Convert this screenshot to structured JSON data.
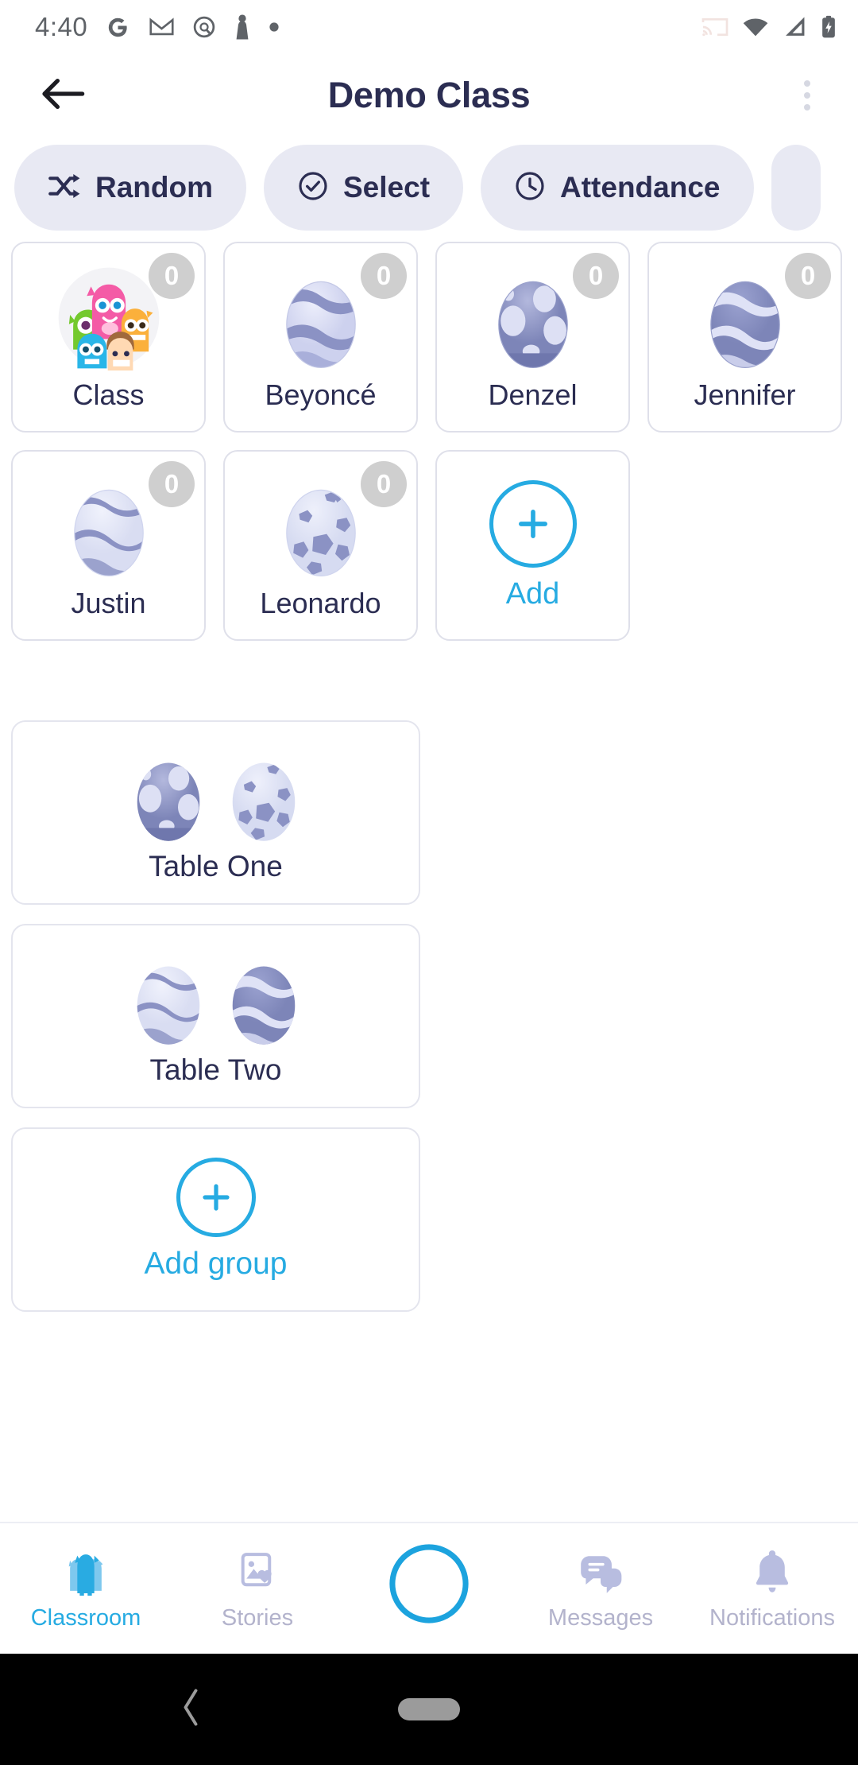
{
  "status_bar": {
    "time": "4:40",
    "left_icons": [
      "google-icon",
      "gmail-icon",
      "chat-icon",
      "chess-pawn-icon",
      "dot-icon"
    ],
    "right_icons": [
      "cast-icon",
      "wifi-icon",
      "cellular-signal-icon",
      "battery-charging-icon"
    ]
  },
  "header": {
    "back_icon": "back-arrow-icon",
    "title": "Demo Class",
    "menu_icon": "kebab-menu-icon"
  },
  "toolbar": {
    "pills": [
      {
        "label": "Random",
        "icon": "shuffle-icon"
      },
      {
        "label": "Select",
        "icon": "check-circle-icon"
      },
      {
        "label": "Attendance",
        "icon": "clock-icon"
      }
    ],
    "partial_pill_visible": true
  },
  "students": [
    {
      "name": "Class",
      "points": "0",
      "avatar": "class-monsters-avatar"
    },
    {
      "name": "Beyoncé",
      "points": "0",
      "avatar": "egg-wave-light-avatar"
    },
    {
      "name": "Denzel",
      "points": "0",
      "avatar": "egg-spotted-dark-avatar"
    },
    {
      "name": "Jennifer",
      "points": "0",
      "avatar": "egg-wave-dark-avatar"
    },
    {
      "name": "Justin",
      "points": "0",
      "avatar": "egg-wave-pale-avatar"
    },
    {
      "name": "Leonardo",
      "points": "0",
      "avatar": "egg-rock-pale-avatar"
    }
  ],
  "add_student": {
    "label": "Add",
    "icon": "plus-circle-icon"
  },
  "groups": [
    {
      "name": "Table One",
      "avatars": [
        "egg-spotted-dark-avatar",
        "egg-rock-pale-avatar"
      ]
    },
    {
      "name": "Table Two",
      "avatars": [
        "egg-wave-pale-avatar",
        "egg-wave-dark-avatar"
      ]
    }
  ],
  "add_group": {
    "label": "Add group",
    "icon": "plus-circle-icon"
  },
  "bottom_nav": [
    {
      "label": "Classroom",
      "icon": "classroom-monsters-icon",
      "active": true
    },
    {
      "label": "Stories",
      "icon": "stories-photo-heart-icon",
      "active": false
    },
    {
      "label": "",
      "icon": "camera-shutter-icon",
      "active": false
    },
    {
      "label": "Messages",
      "icon": "messages-bubbles-icon",
      "active": false
    },
    {
      "label": "Notifications",
      "icon": "bell-icon",
      "active": false
    }
  ],
  "android_nav": {
    "back_icon": "system-back-icon",
    "home_icon": "system-home-pill-icon"
  },
  "colors": {
    "accent": "#26ABE2",
    "title_navy": "#2b2d52",
    "pill_bg": "#e8e9f3",
    "card_border": "#dfe0ea",
    "badge_bg": "#cfcfcf",
    "nav_inactive": "#b3b3cc"
  }
}
